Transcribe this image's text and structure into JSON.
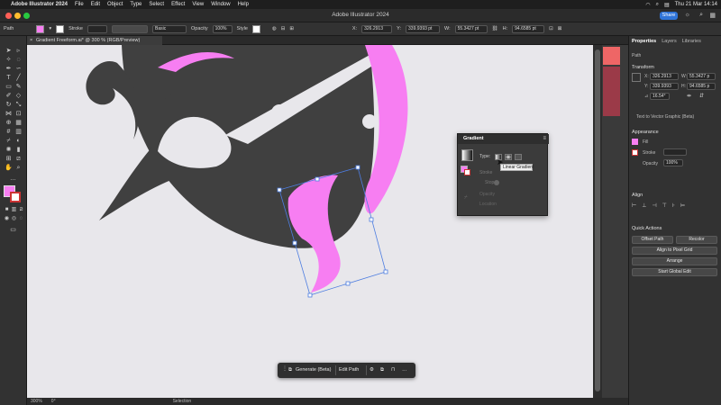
{
  "menubar": {
    "app": "Adobe Illustrator 2024",
    "menus": [
      "File",
      "Edit",
      "Object",
      "Type",
      "Select",
      "Effect",
      "View",
      "Window",
      "Help"
    ],
    "datetime": "Thu 21 Mar 14:14"
  },
  "window": {
    "title": "Adobe Illustrator 2024",
    "share_label": "Share"
  },
  "controlbar": {
    "object_type": "Path",
    "stroke_label": "Stroke",
    "brush_label": "Basic",
    "opacity_label": "Opacity",
    "opacity_value": "100%",
    "style_label": "Style",
    "x_value": "326.2913",
    "y_value": "339.9393 pt",
    "w_value": "55.3427 pt",
    "h_value": "94.6585 pt"
  },
  "document": {
    "tab_label": "Gradient Freeform.ai* @ 300 % (RGB/Preview)"
  },
  "statusbar": {
    "zoom": "300%",
    "rotation": "0°",
    "tool": "Selection"
  },
  "panels": {
    "tabs": [
      "Properties",
      "Layers",
      "Libraries"
    ],
    "selection_type": "Path",
    "transform_title": "Transform",
    "x_value": "326.2913",
    "y_value": "339.9393",
    "w_value": "55.3427 p",
    "h_value": "94.6585 p",
    "angle_value": "16.54°",
    "text_to_vector": "Text to Vector Graphic (Beta)",
    "appearance_title": "Appearance",
    "fill_label": "Fill",
    "stroke_label": "Stroke",
    "opacity_label": "Opacity",
    "opacity_value": "100%",
    "align_title": "Align",
    "quick_actions_title": "Quick Actions",
    "offset_path": "Offset Path",
    "recolor": "Recolor",
    "align_pixel_grid": "Align to Pixel Grid",
    "arrange": "Arrange",
    "start_global_edit": "Start Global Edit"
  },
  "gradient_panel": {
    "title": "Gradient",
    "type_label": "Type:",
    "stroke_label": "Stroke",
    "stop_label": "Stop",
    "opacity_label": "Opacity",
    "location_label": "Location",
    "tooltip": "Linear Gradient"
  },
  "taskbar": {
    "generate": "Generate (Beta)",
    "edit_path": "Edit Path"
  },
  "colors": {
    "accent_pink": "#f77ef2",
    "dark_shape": "#404040",
    "canvas_bg": "#e8e7eb",
    "share_blue": "#2f74d8"
  }
}
